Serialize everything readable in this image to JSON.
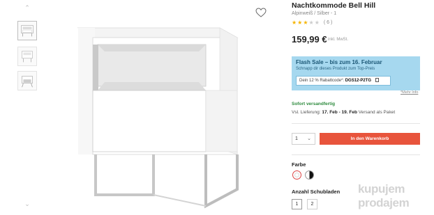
{
  "product": {
    "title": "Nachtkommode Bell Hill",
    "variant": "Alpinweiß / Silber - 1",
    "rating": 3,
    "rating_max": 5,
    "rating_count": "( 6 )",
    "price": "159,99 €",
    "price_note": "inkl. MwSt."
  },
  "promo": {
    "title": "Flash Sale – bis zum 16. Februar",
    "subtitle": "Schnapp dir dieses Produkt zum Top-Preis",
    "code_label": "Dein 12 % Rabattcode*:",
    "code": "DGS12-P2TG",
    "more_info": "*Mehr Info",
    "background": "#a6d8ef"
  },
  "shipping": {
    "status": "Sofort versandfertig",
    "delivery_prefix": "Vsl. Lieferung:",
    "delivery_dates": "17. Feb - 19. Feb",
    "delivery_suffix": "Versand als Paket",
    "status_color": "#2e8b3e"
  },
  "purchase": {
    "quantity": "1",
    "cart_button": "In den Warenkorb",
    "cart_color": "#e8543c"
  },
  "options": {
    "color_label": "Farbe",
    "colors": [
      "white",
      "black-white"
    ],
    "drawers_label": "Anzahl Schubladen",
    "drawers": [
      "1",
      "2"
    ],
    "drawers_selected": "1"
  },
  "gallery": {
    "thumbnail_count": 3,
    "icons": [
      "chevron-up-icon",
      "chevron-down-icon",
      "heart-icon"
    ]
  },
  "watermark": {
    "line1": "kupujem",
    "line2": "prodajem"
  }
}
